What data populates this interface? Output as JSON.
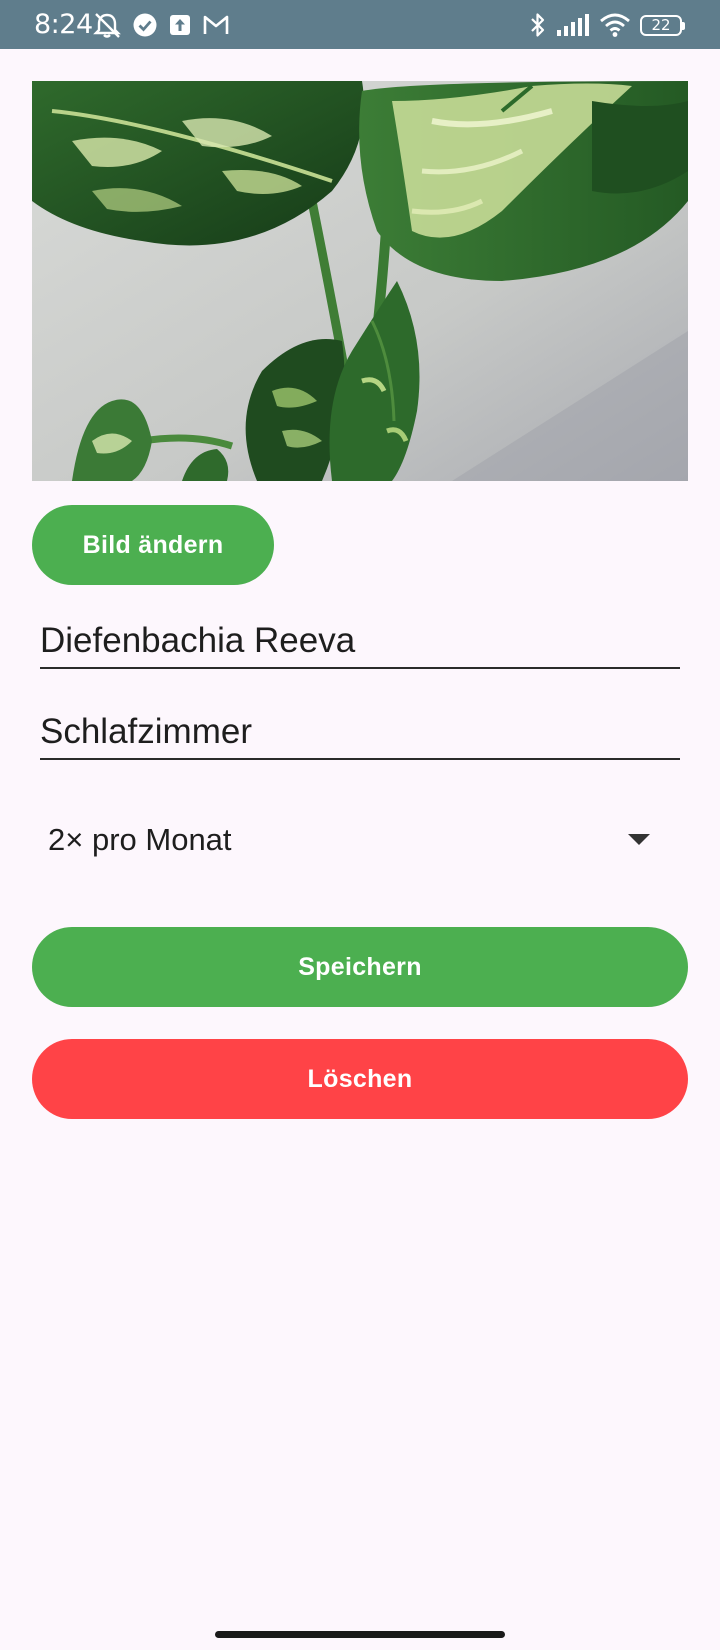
{
  "status_bar": {
    "time": "8:24",
    "battery_level": "22",
    "background_color": "#5F7D8C",
    "left_icons": [
      "alarm-off-icon",
      "check-circle-icon",
      "upload-icon",
      "gmail-icon"
    ],
    "right_icons": [
      "bluetooth-icon",
      "signal-icon",
      "wifi-icon",
      "battery-icon"
    ]
  },
  "plant_image": {
    "icon": "plant-photo"
  },
  "buttons": {
    "change_image_label": "Bild ändern",
    "save_label": "Speichern",
    "delete_label": "Löschen"
  },
  "fields": {
    "name_value": "Diefenbachia Reeva",
    "room_value": "Schlafzimmer"
  },
  "watering_spinner": {
    "selected": "2× pro Monat"
  },
  "colors": {
    "accent_green": "#4CAF50",
    "danger_red": "#FF4347",
    "background": "#FDF7FD"
  }
}
